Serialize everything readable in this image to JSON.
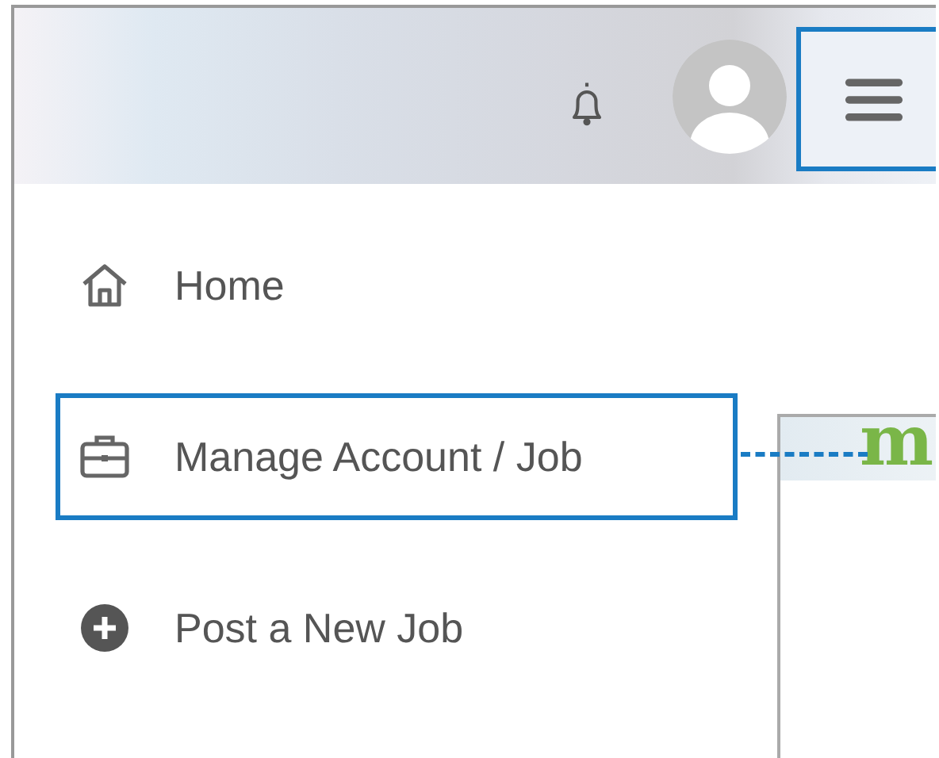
{
  "header": {
    "menu_button": {
      "highlighted": true
    }
  },
  "menu": [
    {
      "label": "Home",
      "highlighted": false
    },
    {
      "label": "Manage Account / Job",
      "highlighted": true
    },
    {
      "label": "Post a New Job",
      "highlighted": false
    }
  ],
  "inset": {
    "logo_text": "m"
  }
}
